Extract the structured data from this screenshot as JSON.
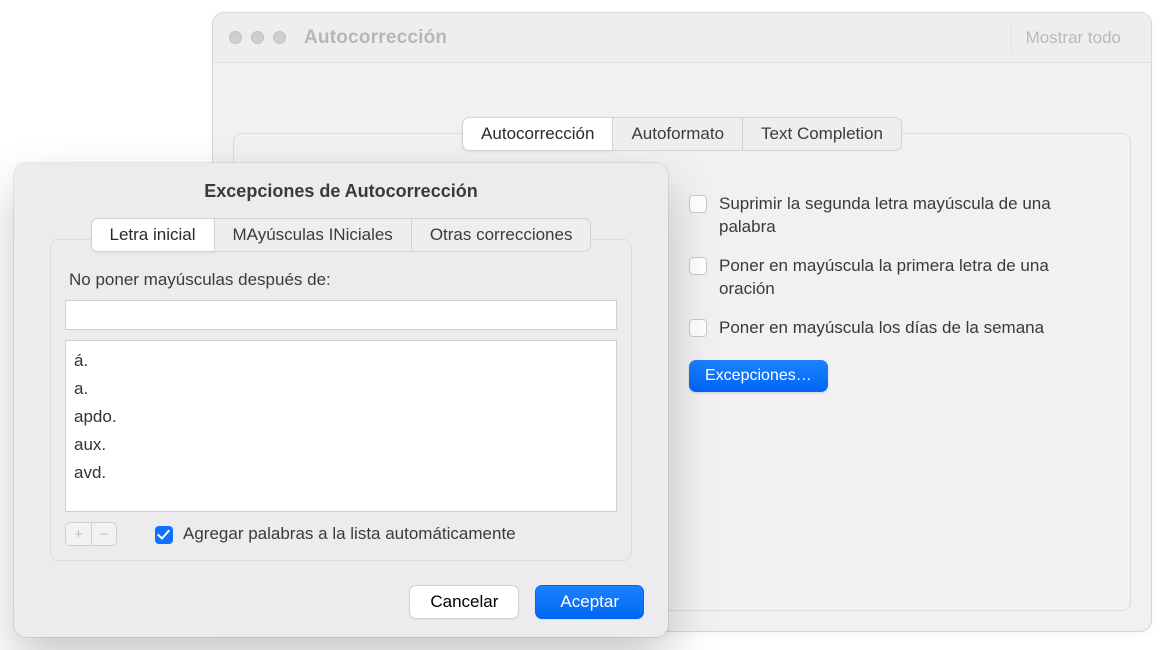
{
  "back": {
    "window_title": "Autocorrección",
    "show_all": "Mostrar todo",
    "tabs": [
      {
        "label": "Autocorrección",
        "active": true
      },
      {
        "label": "Autoformato",
        "active": false
      },
      {
        "label": "Text Completion",
        "active": false
      }
    ],
    "options": [
      {
        "label": "Suprimir la segunda letra mayúscula de una palabra"
      },
      {
        "label": "Poner en mayúscula la primera letra de una oración"
      },
      {
        "label": "Poner en mayúscula los días de la semana"
      }
    ],
    "exceptions_button": "Excepciones…"
  },
  "front": {
    "title": "Excepciones de Autocorrección",
    "tabs": [
      {
        "label": "Letra inicial",
        "active": true
      },
      {
        "label": "MAyúsculas INiciales",
        "active": false
      },
      {
        "label": "Otras correcciones",
        "active": false
      }
    ],
    "field_label": "No poner mayúsculas después de:",
    "field_value": "",
    "items": [
      "á.",
      "a.",
      "apdo.",
      "aux.",
      "avd."
    ],
    "plus": "+",
    "minus": "−",
    "auto_add_checked": true,
    "auto_add_label": "Agregar palabras a la lista automáticamente",
    "cancel": "Cancelar",
    "ok": "Aceptar"
  }
}
